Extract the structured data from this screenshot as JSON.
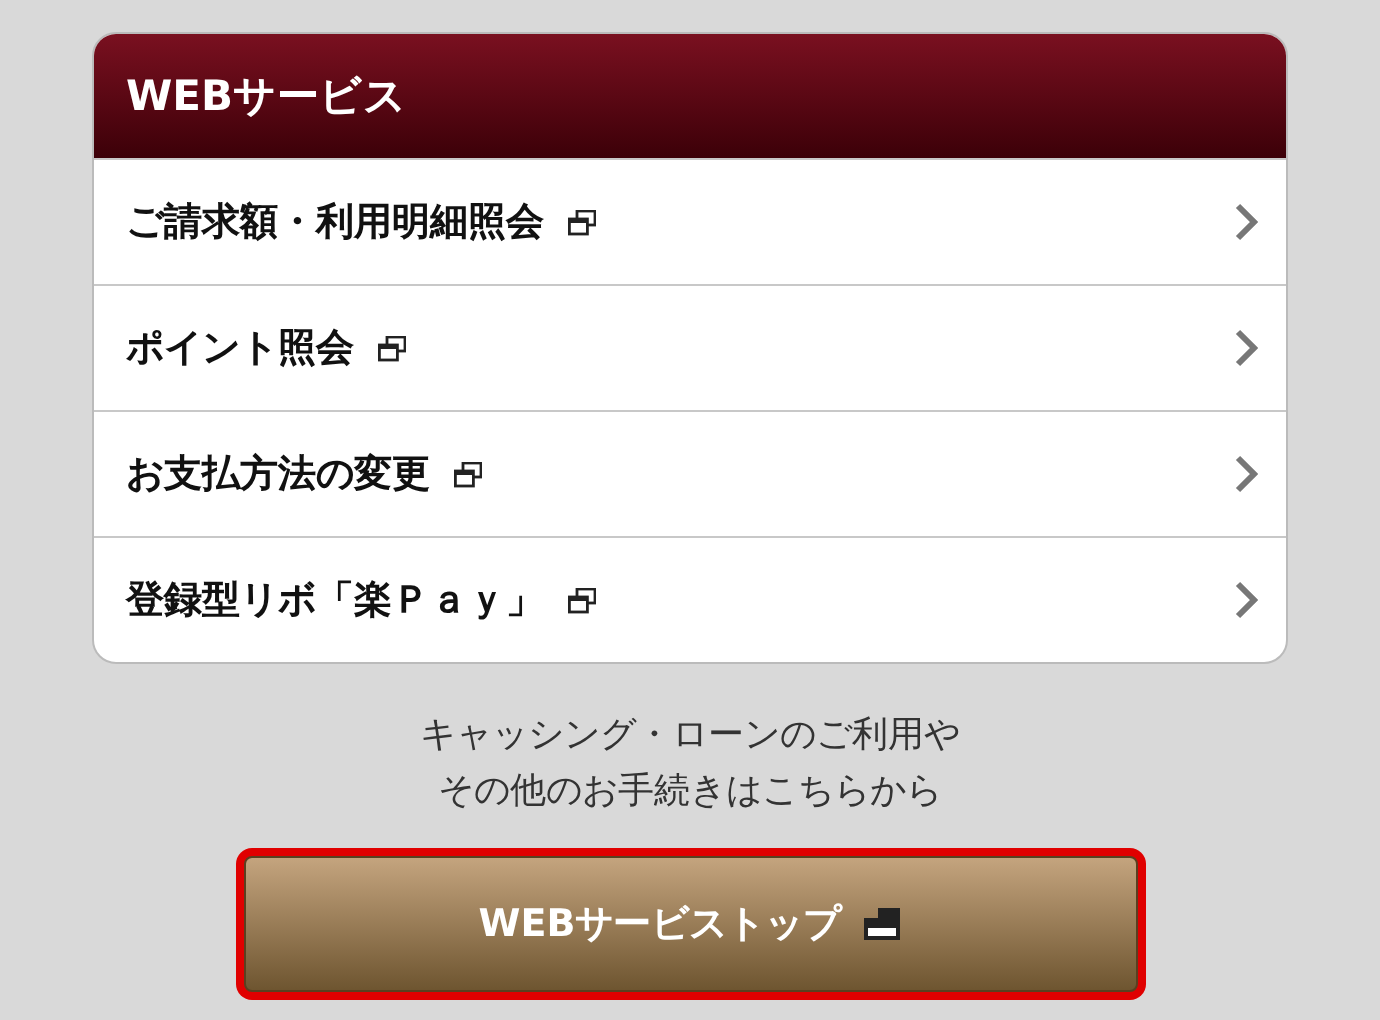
{
  "panel": {
    "title": "WEBサービス",
    "items": [
      {
        "label": "ご請求額・利用明細照会"
      },
      {
        "label": "ポイント照会"
      },
      {
        "label": "お支払方法の変更"
      },
      {
        "label": "登録型リボ「楽Ｐａｙ」"
      }
    ]
  },
  "note": [
    "キャッシング・ローンのご利用や",
    "その他のお手続きはこちらから"
  ],
  "button": {
    "label": "WEBサービストップ",
    "highlighted": true
  }
}
